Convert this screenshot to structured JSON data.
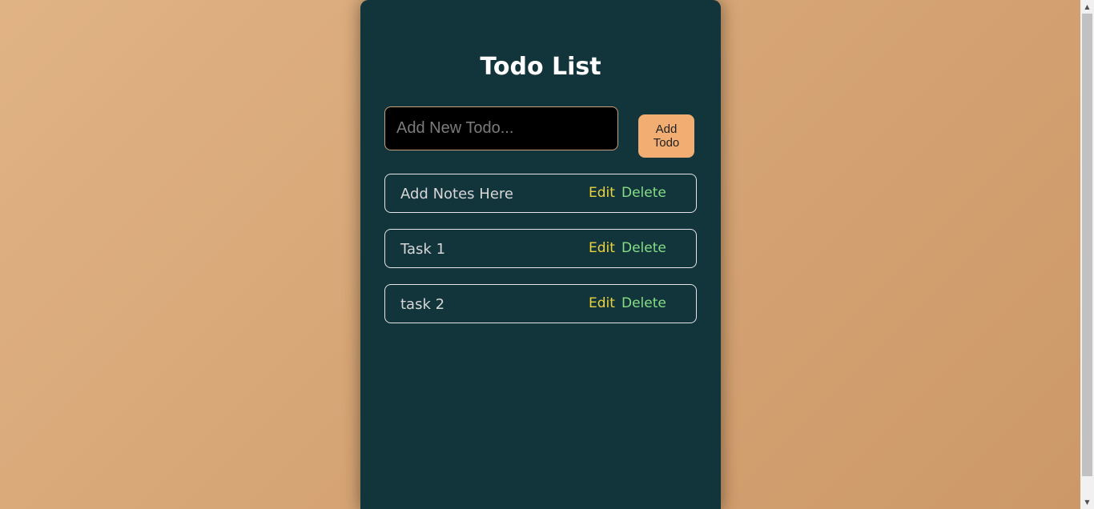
{
  "app": {
    "title": "Todo List"
  },
  "input": {
    "value": "",
    "placeholder": "Add New Todo..."
  },
  "add_button": {
    "label": "Add Todo"
  },
  "todos": [
    {
      "text": "Add Notes Here",
      "edit_label": "Edit",
      "delete_label": "Delete"
    },
    {
      "text": "Task 1",
      "edit_label": "Edit",
      "delete_label": "Delete"
    },
    {
      "text": "task 2",
      "edit_label": "Edit",
      "delete_label": "Delete"
    }
  ],
  "colors": {
    "background": "#d7a676",
    "card": "#12343b",
    "accent": "#f2ae72",
    "edit": "#ecd33c",
    "delete": "#86de86"
  },
  "icons": {
    "scroll_up": "scroll-up-arrow-icon",
    "scroll_down": "scroll-down-arrow-icon"
  }
}
